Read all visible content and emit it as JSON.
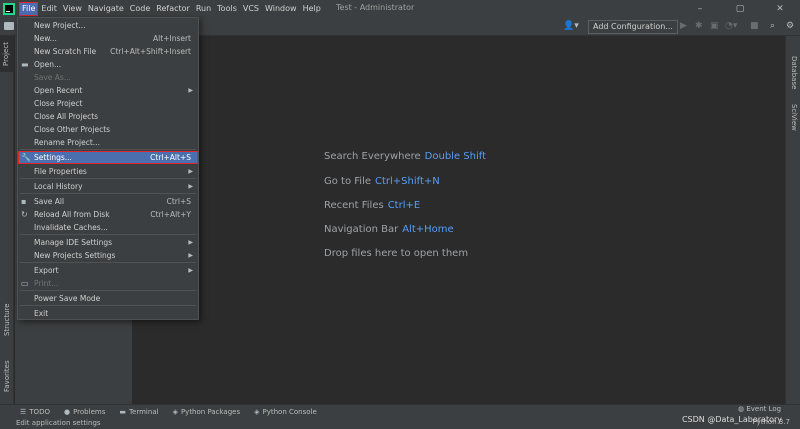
{
  "window": {
    "title": "Test - Administrator",
    "controls": [
      "–",
      "▢",
      "✕"
    ]
  },
  "menubar": [
    "File",
    "Edit",
    "View",
    "Navigate",
    "Code",
    "Refactor",
    "Run",
    "Tools",
    "VCS",
    "Window",
    "Help"
  ],
  "toolbar": {
    "add_configuration": "Add Configuration..."
  },
  "left_strip": {
    "project": "Project",
    "structure": "Structure",
    "favorites": "Favorites"
  },
  "right_strip": {
    "database": "Database",
    "sciview": "SciView"
  },
  "file_menu": {
    "items": [
      {
        "label": "New Project...",
        "shortcut": ""
      },
      {
        "label": "New...",
        "shortcut": "Alt+Insert"
      },
      {
        "label": "New Scratch File",
        "shortcut": "Ctrl+Alt+Shift+Insert"
      },
      {
        "label": "Open...",
        "shortcut": ""
      },
      {
        "label": "Save As...",
        "shortcut": ""
      },
      {
        "label": "Open Recent",
        "shortcut": ""
      },
      {
        "label": "Close Project",
        "shortcut": ""
      },
      {
        "label": "Close All Projects",
        "shortcut": ""
      },
      {
        "label": "Close Other Projects",
        "shortcut": ""
      },
      {
        "label": "Rename Project...",
        "shortcut": ""
      },
      {
        "label": "Settings...",
        "shortcut": "Ctrl+Alt+S"
      },
      {
        "label": "File Properties",
        "shortcut": ""
      },
      {
        "label": "Local History",
        "shortcut": ""
      },
      {
        "label": "Save All",
        "shortcut": "Ctrl+S"
      },
      {
        "label": "Reload All from Disk",
        "shortcut": "Ctrl+Alt+Y"
      },
      {
        "label": "Invalidate Caches...",
        "shortcut": ""
      },
      {
        "label": "Manage IDE Settings",
        "shortcut": ""
      },
      {
        "label": "New Projects Settings",
        "shortcut": ""
      },
      {
        "label": "Export",
        "shortcut": ""
      },
      {
        "label": "Print...",
        "shortcut": ""
      },
      {
        "label": "Power Save Mode",
        "shortcut": ""
      },
      {
        "label": "Exit",
        "shortcut": ""
      }
    ]
  },
  "editor_hints": [
    {
      "label": "Search Everywhere",
      "key": "Double Shift"
    },
    {
      "label": "Go to File",
      "key": "Ctrl+Shift+N"
    },
    {
      "label": "Recent Files",
      "key": "Ctrl+E"
    },
    {
      "label": "Navigation Bar",
      "key": "Alt+Home"
    },
    {
      "label": "Drop files here to open them",
      "key": ""
    }
  ],
  "bottom_tools": {
    "todo": "TODO",
    "problems": "Problems",
    "terminal": "Terminal",
    "python_packages": "Python Packages",
    "python_console": "Python Console",
    "event_log": "Event Log"
  },
  "status": {
    "message": "Edit application settings",
    "interpreter": "Python 3.7",
    "watermark": "CSDN @Data_Laboratory"
  }
}
